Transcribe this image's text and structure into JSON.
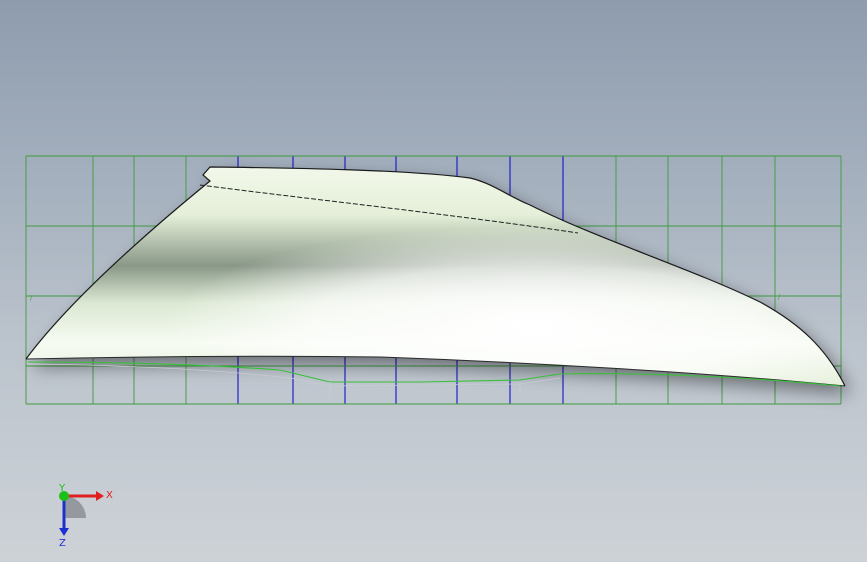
{
  "viewport": {
    "background_top": "#8e9cae",
    "background_bottom": "#cdd2d7"
  },
  "grid": {
    "color": "#3f9a3f",
    "highlight_color": "#2222c8",
    "edge_marker": "∕"
  },
  "model": {
    "surface_color": "#eef7e4",
    "shadow_color": "#7d8b7b",
    "edge_color": "#1a1a1a"
  },
  "triad": {
    "x_label": "X",
    "y_label": "Y",
    "z_label": "Z",
    "x_color": "#e02020",
    "y_color": "#18c018",
    "z_color": "#2030d0"
  }
}
